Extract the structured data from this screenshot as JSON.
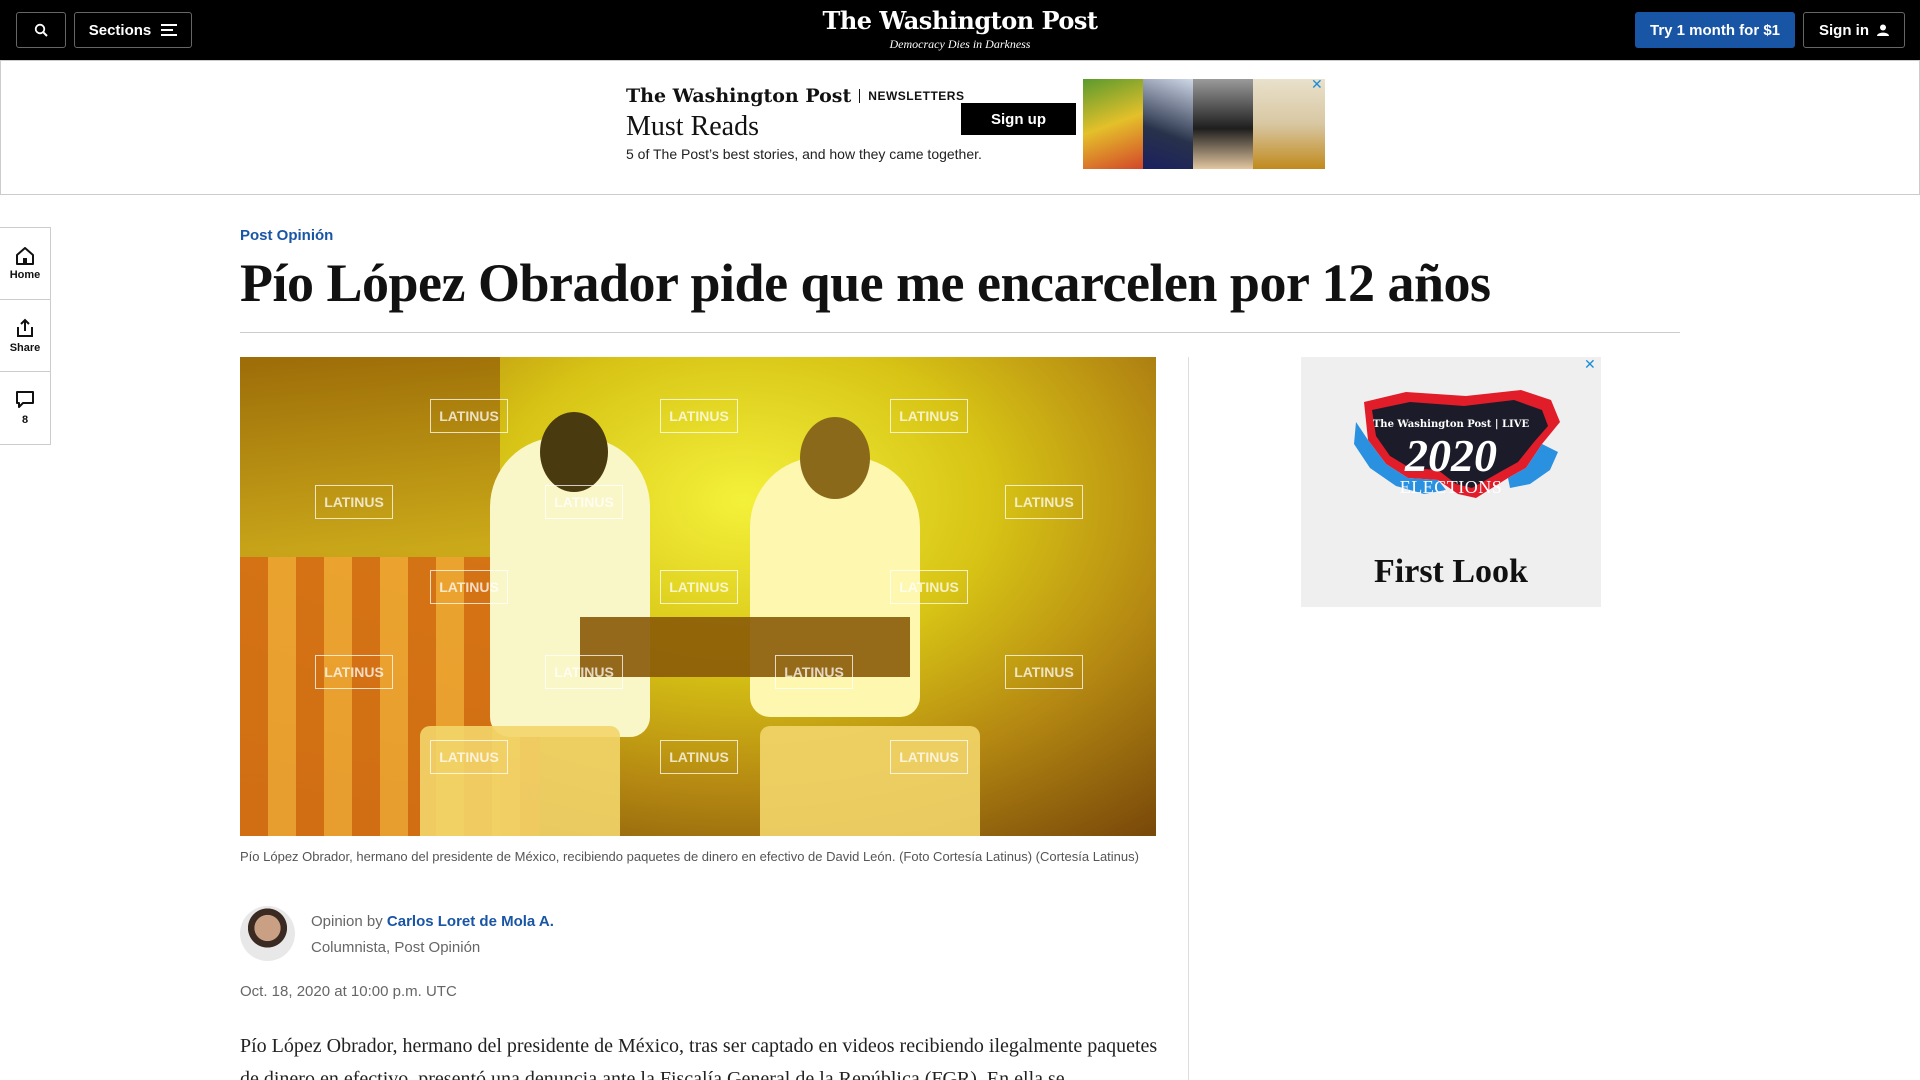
{
  "topbar": {
    "sections_label": "Sections",
    "logo": "The Washington Post",
    "tagline": "Democracy Dies in Darkness",
    "try_label": "Try 1 month for $1",
    "signin_label": "Sign in",
    "try_color": "#1955a5"
  },
  "newsletter_ad": {
    "brand": "The Washington Post",
    "section": "NEWSLETTERS",
    "title": "Must Reads",
    "subtitle": "5 of The Post’s best stories, and how they came together.",
    "signup_label": "Sign up",
    "close_glyph": "✕"
  },
  "rail": {
    "home_label": "Home",
    "share_label": "Share",
    "comments_count": "8"
  },
  "article": {
    "kicker": "Post Opinión",
    "headline": "Pío López Obrador pide que me encarcelen por 12 años",
    "caption": "Pío López Obrador, hermano del presidente de México, recibiendo paquetes de dinero en efectivo de David León. (Foto Cortesía Latinus) (Cortesía Latinus)",
    "watermark": "LATINUS",
    "byline_prefix": "Opinion by",
    "author": "Carlos Loret de Mola A.",
    "author_role": "Columnista, Post Opinión",
    "date": "Oct. 18, 2020 at 10:00 p.m. UTC",
    "body": "Pío López Obrador, hermano del presidente de México, tras ser captado en videos recibiendo ilegalmente paquetes de dinero en efectivo, presentó una denuncia ante la Fiscalía General de la República (FGR). En ella se"
  },
  "election_ad": {
    "brand": "The Washington Post | LIVE",
    "year": "2020",
    "label": "ELECTIONS",
    "first_look": "First Look",
    "close_glyph": "✕"
  }
}
